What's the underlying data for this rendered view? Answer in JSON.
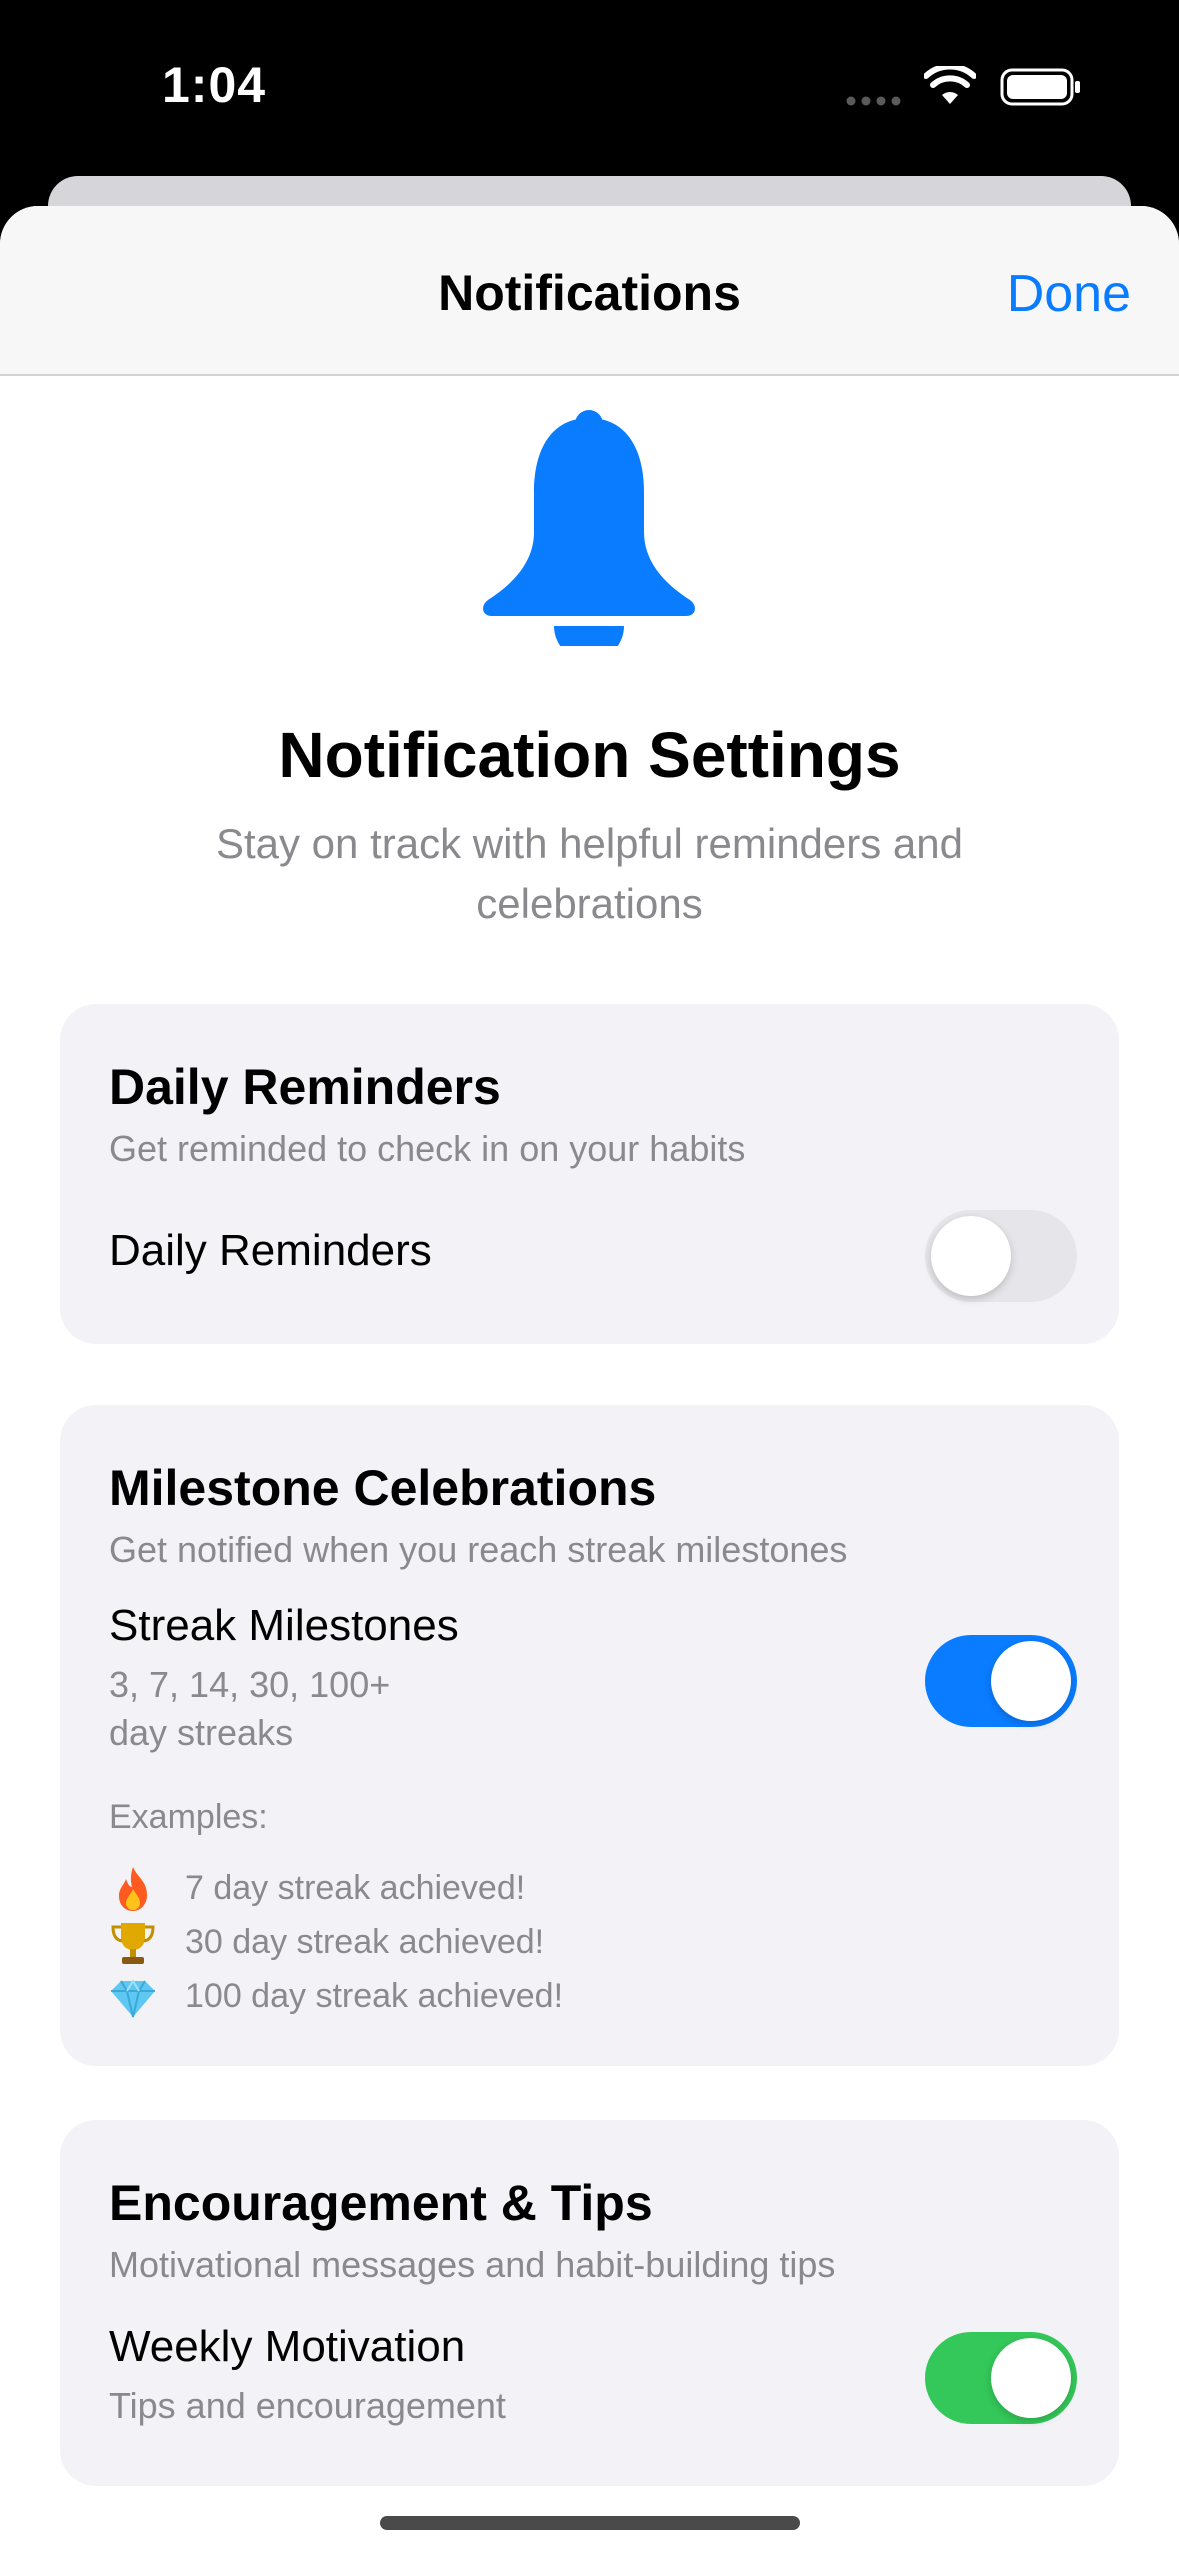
{
  "status_bar": {
    "time": "1:04"
  },
  "nav": {
    "title": "Notifications",
    "done_label": "Done"
  },
  "hero": {
    "icon": "bell-icon",
    "title": "Notification Settings",
    "subtitle": "Stay on track with helpful reminders and celebrations"
  },
  "daily": {
    "title": "Daily Reminders",
    "description": "Get reminded to check in on your habits",
    "row_label": "Daily Reminders",
    "enabled": false
  },
  "milestones": {
    "title": "Milestone Celebrations",
    "description": "Get notified when you reach streak milestones",
    "row_label": "Streak Milestones",
    "row_sub_line1": "3, 7, 14, 30, 100+",
    "row_sub_line2": "day streaks",
    "enabled": true,
    "examples_label": "Examples:",
    "examples": [
      {
        "icon": "fire-icon",
        "text": "7 day streak achieved!"
      },
      {
        "icon": "trophy-icon",
        "text": "30 day streak achieved!"
      },
      {
        "icon": "diamond-icon",
        "text": "100 day streak achieved!"
      }
    ]
  },
  "encouragement": {
    "title": "Encouragement & Tips",
    "description": "Motivational messages and habit-building tips",
    "row_label": "Weekly Motivation",
    "row_sub": "Tips and encouragement",
    "enabled": true
  },
  "colors": {
    "accent": "#0a7cff",
    "toggle_on_blue": "#0a7cff",
    "toggle_on_green": "#34c759",
    "toggle_off": "#e5e5ea",
    "card_bg": "#f2f2f7",
    "secondary_text": "#8a8a8e"
  }
}
